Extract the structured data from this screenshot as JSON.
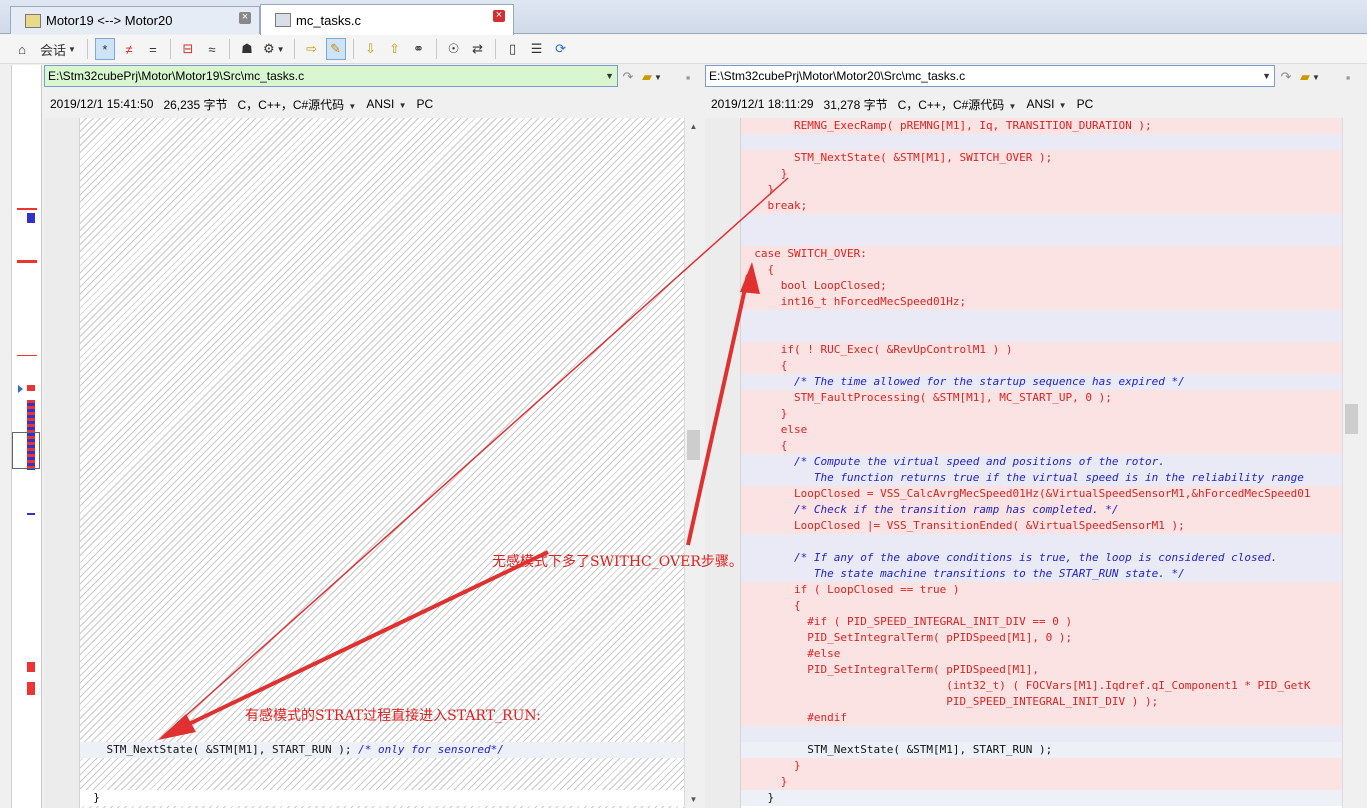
{
  "tabs": [
    {
      "label": "Motor19 <--> Motor20"
    },
    {
      "label": "mc_tasks.c"
    }
  ],
  "toolbar": {
    "session_label": "会话",
    "buttons": [
      "home-icon",
      "star-icon",
      "not-equal-icon",
      "equal-icon",
      "diff-icon",
      "approx-icon",
      "user-icon",
      "rules-icon",
      "arrow-right-icon",
      "edit-icon",
      "down-arrow-icon",
      "up-arrow-icon",
      "binoculars-icon",
      "target-icon",
      "swap-icon",
      "expand-icon",
      "columns-icon",
      "refresh-icon"
    ],
    "star": "*",
    "not_equal": "≠",
    "equal": "=",
    "approx": "≈"
  },
  "left": {
    "path": "E:\\Stm32cubePrj\\Motor\\Motor19\\Src\\mc_tasks.c",
    "date": "2019/12/1 15:41:50",
    "size": "26,235 字节",
    "lang": "C，C++，C#源代码",
    "enc": "ANSI",
    "eol": "PC",
    "lines": [
      {
        "text": "    STM_NextState( &STM[M1], START_RUN ); ",
        "comment": "/* only for sensored*/"
      },
      {
        "text": "  }",
        "comment": ""
      }
    ]
  },
  "right": {
    "path": "E:\\Stm32cubePrj\\Motor\\Motor20\\Src\\mc_tasks.c",
    "date": "2019/12/1 18:11:29",
    "size": "31,278 字节",
    "lang": "C，C++，C#源代码",
    "enc": "ANSI",
    "eol": "PC",
    "lines": [
      {
        "t": "        REMNG_ExecRamp( pREMNG[M1], Iq, TRANSITION_DURATION );",
        "c": "",
        "k": "diff"
      },
      {
        "t": "",
        "c": "",
        "k": "blank"
      },
      {
        "t": "        STM_NextState( &STM[M1], SWITCH_OVER );",
        "c": "",
        "k": "diff"
      },
      {
        "t": "      }",
        "c": "",
        "k": "diff"
      },
      {
        "t": "    }",
        "c": "",
        "k": "diff"
      },
      {
        "t": "    break;",
        "c": "",
        "k": "diff"
      },
      {
        "t": "",
        "c": "",
        "k": "blank"
      },
      {
        "t": "",
        "c": "",
        "k": "blank"
      },
      {
        "t": "  case SWITCH_OVER:",
        "c": "",
        "k": "diff"
      },
      {
        "t": "    {",
        "c": "",
        "k": "diff"
      },
      {
        "t": "      bool LoopClosed;",
        "c": "",
        "k": "diff"
      },
      {
        "t": "      int16_t hForcedMecSpeed01Hz;",
        "c": "",
        "k": "diff"
      },
      {
        "t": "",
        "c": "",
        "k": "blank"
      },
      {
        "t": "",
        "c": "",
        "k": "blank"
      },
      {
        "t": "      if( ! RUC_Exec( &RevUpControlM1 ) )",
        "c": "",
        "k": "diff"
      },
      {
        "t": "      {",
        "c": "",
        "k": "diff"
      },
      {
        "t": "        ",
        "c": "/* The time allowed for the startup sequence has expired */",
        "k": "blank"
      },
      {
        "t": "        STM_FaultProcessing( &STM[M1], MC_START_UP, 0 );",
        "c": "",
        "k": "diff"
      },
      {
        "t": "      }",
        "c": "",
        "k": "diff"
      },
      {
        "t": "      else",
        "c": "",
        "k": "diff"
      },
      {
        "t": "      {",
        "c": "",
        "k": "diff"
      },
      {
        "t": "        ",
        "c": "/* Compute the virtual speed and positions of the rotor.",
        "k": "blank"
      },
      {
        "t": "           ",
        "c": "The function returns true if the virtual speed is in the reliability range",
        "k": "blank"
      },
      {
        "t": "        LoopClosed = VSS_CalcAvrgMecSpeed01Hz(&VirtualSpeedSensorM1,&hForcedMecSpeed01",
        "c": "",
        "k": "diff"
      },
      {
        "t": "        ",
        "c": "/* Check if the transition ramp has completed. */",
        "k": "diff"
      },
      {
        "t": "        LoopClosed |= VSS_TransitionEnded( &VirtualSpeedSensorM1 );",
        "c": "",
        "k": "diff"
      },
      {
        "t": "",
        "c": "",
        "k": "blank"
      },
      {
        "t": "        ",
        "c": "/* If any of the above conditions is true, the loop is considered closed.",
        "k": "blank"
      },
      {
        "t": "           ",
        "c": "The state machine transitions to the START_RUN state. */",
        "k": "blank"
      },
      {
        "t": "        if ( LoopClosed == true )",
        "c": "",
        "k": "diff"
      },
      {
        "t": "        {",
        "c": "",
        "k": "diff"
      },
      {
        "t": "          #if ( PID_SPEED_INTEGRAL_INIT_DIV == 0 )",
        "c": "",
        "k": "diff"
      },
      {
        "t": "          PID_SetIntegralTerm( pPIDSpeed[M1], 0 );",
        "c": "",
        "k": "diff"
      },
      {
        "t": "          #else",
        "c": "",
        "k": "diff"
      },
      {
        "t": "          PID_SetIntegralTerm( pPIDSpeed[M1],",
        "c": "",
        "k": "diff"
      },
      {
        "t": "                               (int32_t) ( FOCVars[M1].Iqdref.qI_Component1 * PID_GetK",
        "c": "",
        "k": "diff"
      },
      {
        "t": "                               PID_SPEED_INTEGRAL_INIT_DIV ) );",
        "c": "",
        "k": "diff"
      },
      {
        "t": "          #endif",
        "c": "",
        "k": "diff"
      },
      {
        "t": "",
        "c": "",
        "k": "blank"
      },
      {
        "t": "          STM_NextState( &STM[M1], START_RUN );",
        "c": "",
        "k": "same"
      },
      {
        "t": "        }",
        "c": "",
        "k": "diff"
      },
      {
        "t": "      }",
        "c": "",
        "k": "diff"
      },
      {
        "t": "    }",
        "c": "",
        "k": "same"
      }
    ]
  },
  "annotations": {
    "right_note": "无感模式下多了SWITHC_OVER步骤。",
    "left_note": "有感模式的STRAT过程直接进入START_RUN:"
  },
  "colors": {
    "diff_text": "#d22222",
    "diff_bg": "#fbe3e3",
    "comment": "#2222cc",
    "annotation": "#e02020"
  }
}
